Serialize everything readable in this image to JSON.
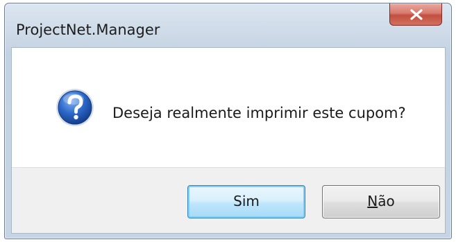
{
  "window": {
    "title": "ProjectNet.Manager",
    "close_icon": "close-icon"
  },
  "dialog": {
    "icon": "question-icon",
    "message": "Deseja realmente imprimir este cupom?"
  },
  "buttons": {
    "yes_label": "Sim",
    "no_label_first": "N",
    "no_label_rest": "ão"
  },
  "colors": {
    "close_button": "#c24f3f",
    "default_button_border": "#3c7fb1",
    "question_icon_blue": "#1f5bb6"
  }
}
